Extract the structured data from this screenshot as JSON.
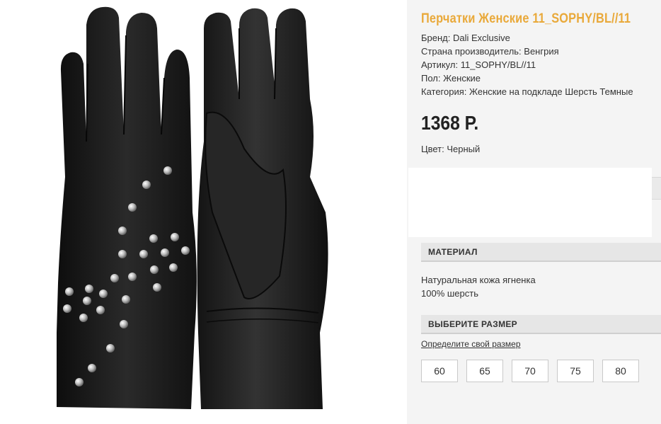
{
  "product": {
    "title": "Перчатки Женские 11_SOPHY/BL//11",
    "brand": "Бренд: Dali Exclusive",
    "country": "Страна производитель: Венгрия",
    "article": "Артикул: 11_SOPHY/BL//11",
    "gender": "Пол: Женские",
    "category": "Категория: Женские на подкладе Шерсть Темные",
    "price": "1368 Р.",
    "color": "Цвет: Черный"
  },
  "material": {
    "heading": "МАТЕРИАЛ",
    "line1": "Натуральная кожа ягненка",
    "line2": "100% шерсть"
  },
  "size": {
    "heading": "ВЫБЕРИТЕ РАЗМЕР",
    "link": "Определите свой размер",
    "options": [
      "60",
      "65",
      "70",
      "75",
      "80"
    ]
  },
  "colors": {
    "title": "#e9a93a",
    "panel": "#f4f4f4",
    "glove": "#1c1c1c"
  }
}
